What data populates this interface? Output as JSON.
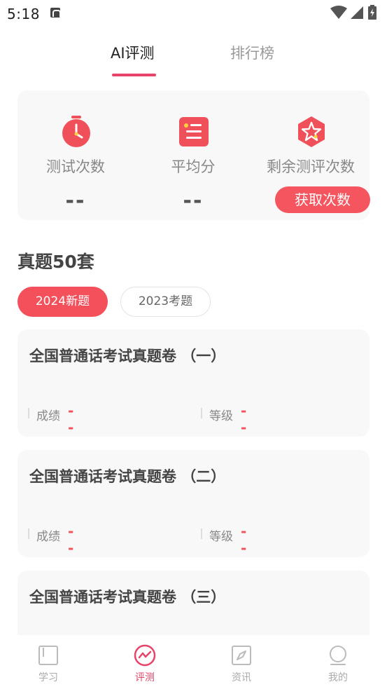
{
  "status_bar": {
    "time": "5:18"
  },
  "top_tabs": {
    "active": "AI评测",
    "inactive": "排行榜"
  },
  "stats": {
    "tests_label": "测试次数",
    "tests_value": "--",
    "average_label": "平均分",
    "average_value": "--",
    "remaining_label": "剩余测评次数",
    "get_button": "获取次数"
  },
  "section": {
    "title": "真题50套",
    "year_tabs": [
      "2024新题",
      "2023考题"
    ]
  },
  "exams": [
    {
      "title": "全国普通话考试真题卷 （一）",
      "score_label": "成绩",
      "score_value": "--",
      "grade_label": "等级",
      "grade_value": "--"
    },
    {
      "title": "全国普通话考试真题卷 （二）",
      "score_label": "成绩",
      "score_value": "--",
      "grade_label": "等级",
      "grade_value": "--"
    },
    {
      "title": "全国普通话考试真题卷 （三）"
    }
  ],
  "bottom_nav": [
    {
      "label": "学习",
      "icon": "book-icon"
    },
    {
      "label": "评测",
      "icon": "chart-wave-icon"
    },
    {
      "label": "资讯",
      "icon": "compass-icon"
    },
    {
      "label": "我的",
      "icon": "profile-icon"
    }
  ],
  "colors": {
    "accent": "#e8436a",
    "button": "#f5555e",
    "card_bg": "#f8f8f9"
  }
}
